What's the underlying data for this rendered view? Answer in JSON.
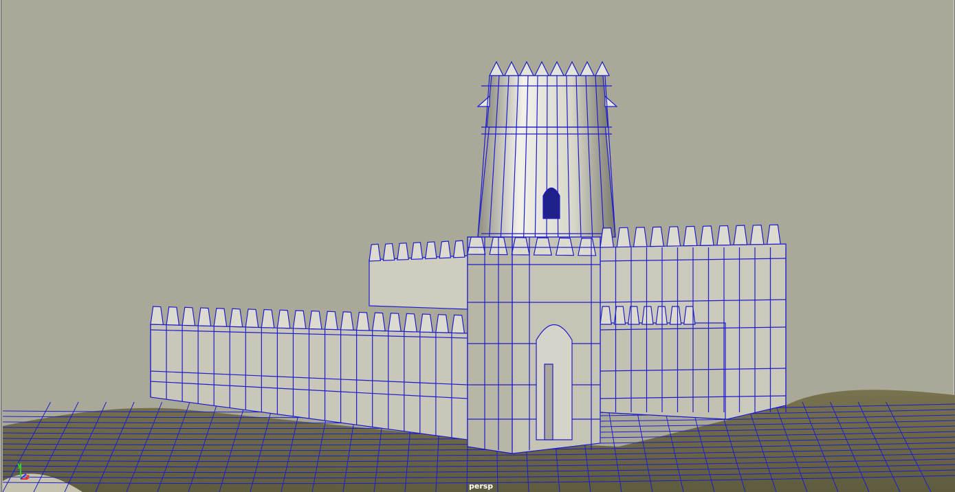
{
  "viewport": {
    "camera_label": "persp",
    "axis_gizmo": {
      "y_label": "y",
      "x_label": "x",
      "z_label": "z"
    },
    "colors": {
      "background": "#aaa999",
      "terrain": "#6e6a4b",
      "model": "#c9c7b8",
      "wireframe": "#1c1ccc"
    }
  }
}
